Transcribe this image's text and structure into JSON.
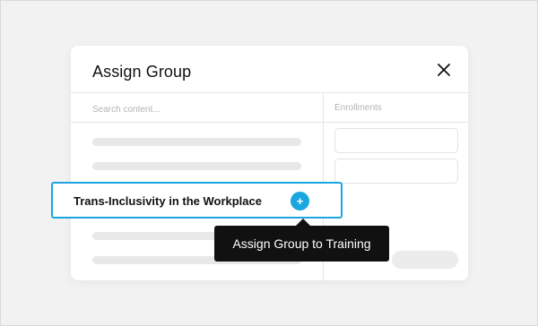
{
  "modal": {
    "title": "Assign Group",
    "close_icon": "close-icon"
  },
  "search": {
    "placeholder": "Search content..."
  },
  "enrollments": {
    "label": "Enrollments"
  },
  "highlighted_item": {
    "title": "Trans-Inclusivity in the Workplace",
    "add_icon": "plus-icon",
    "add_symbol": "+"
  },
  "tooltip": {
    "text": "Assign Group to Training"
  },
  "colors": {
    "accent": "#1aa7e0",
    "tooltip_bg": "#111111",
    "background": "#f2f2f2"
  }
}
